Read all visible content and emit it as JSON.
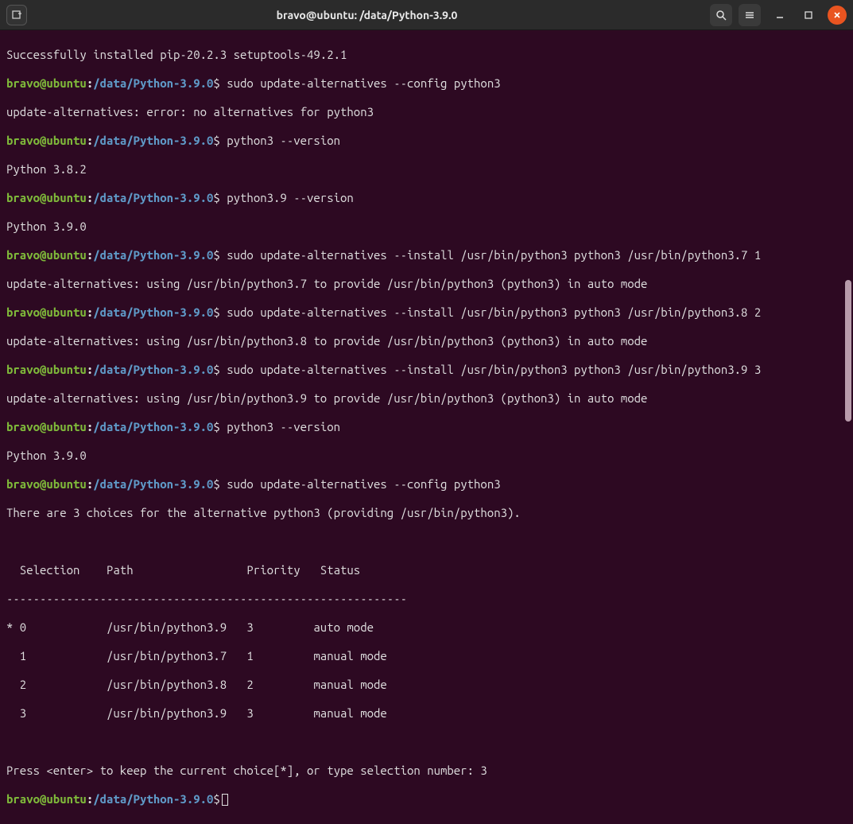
{
  "titlebar": {
    "title": "bravo@ubuntu: /data/Python-3.9.0"
  },
  "prompt": {
    "user": "bravo@ubuntu",
    "path": "/data/Python-3.9.0",
    "dollar": "$"
  },
  "lines": {
    "l0": "Successfully installed pip-20.2.3 setuptools-49.2.1",
    "c1": " sudo update-alternatives --config python3",
    "l2": "update-alternatives: error: no alternatives for python3",
    "c3": " python3 --version",
    "l4": "Python 3.8.2",
    "c5": " python3.9 --version",
    "l6": "Python 3.9.0",
    "c7": " sudo update-alternatives --install /usr/bin/python3 python3 /usr/bin/python3.7 1",
    "l8": "update-alternatives: using /usr/bin/python3.7 to provide /usr/bin/python3 (python3) in auto mode",
    "c9": " sudo update-alternatives --install /usr/bin/python3 python3 /usr/bin/python3.8 2",
    "l10": "update-alternatives: using /usr/bin/python3.8 to provide /usr/bin/python3 (python3) in auto mode",
    "c11": " sudo update-alternatives --install /usr/bin/python3 python3 /usr/bin/python3.9 3",
    "l12": "update-alternatives: using /usr/bin/python3.9 to provide /usr/bin/python3 (python3) in auto mode",
    "c13": " python3 --version",
    "l14": "Python 3.9.0",
    "c15": " sudo update-alternatives --config python3",
    "l16": "There are 3 choices for the alternative python3 (providing /usr/bin/python3).",
    "blank": " ",
    "thead": "  Selection    Path                 Priority   Status",
    "tsep": "------------------------------------------------------------",
    "r0": "* 0            /usr/bin/python3.9   3         auto mode",
    "r1": "  1            /usr/bin/python3.7   1         manual mode",
    "r2": "  2            /usr/bin/python3.8   2         manual mode",
    "r3": "  3            /usr/bin/python3.9   3         manual mode",
    "pressenter": "Press <enter> to keep the current choice[*], or type selection number: 3"
  }
}
